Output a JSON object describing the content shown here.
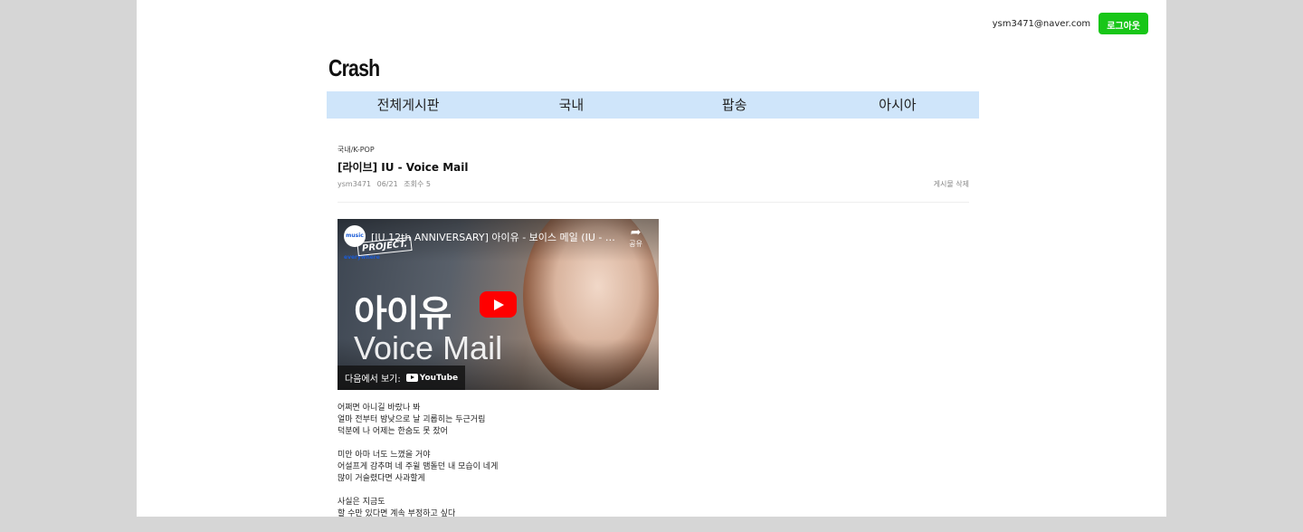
{
  "header": {
    "email": "ysm3471@naver.com",
    "logout_label": "로그아웃",
    "logo": "Crash"
  },
  "nav": [
    "전체게시판",
    "국내",
    "팝송",
    "아시아"
  ],
  "post": {
    "category": "국내/K-POP",
    "title": "[라이브] IU - Voice Mail",
    "author": "ysm3471",
    "date": "06/21",
    "views": "조회수 5",
    "delete_label": "게시물 삭제"
  },
  "video": {
    "channel": "music everywhere",
    "title": "[IU 12th ANNIVERSARY] 아이유 - 보이스 메일 (IU - Voic...",
    "project_tag": "PROJECT.",
    "share_label": "공유",
    "overlay_name": "아이유",
    "overlay_song": "Voice Mail",
    "watch_on": "다음에서 보기:",
    "youtube": "YouTube"
  },
  "lyrics": [
    [
      "어쩌면 아니길 바랐나 봐",
      "얼마 전부터 밤낮으로 날 괴롭히는 두근거림",
      "덕분에 나 어제는 한숨도 못 잤어"
    ],
    [
      "미안 아마 너도 느꼈을 거야",
      "어설프게 감추며 네 주윌 맴돌던 내 모습이 네게",
      "많이 거슬렸다면 사과할게"
    ],
    [
      "사실은 지금도",
      "할 수만 있다면 계속 부정하고 싶다"
    ]
  ]
}
